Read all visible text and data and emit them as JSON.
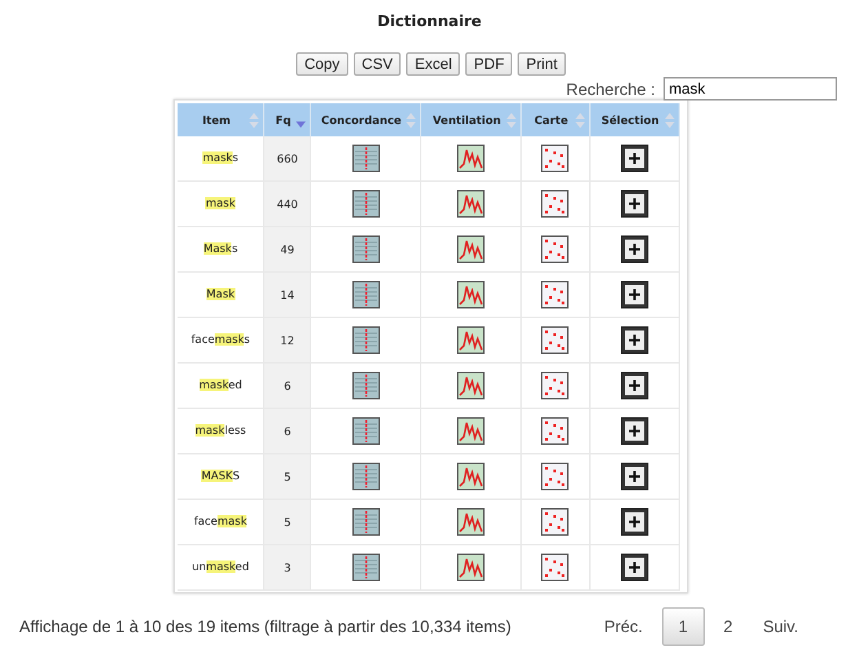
{
  "title": "Dictionnaire",
  "export_buttons": [
    "Copy",
    "CSV",
    "Excel",
    "PDF",
    "Print"
  ],
  "search": {
    "label": "Recherche :",
    "value": "mask"
  },
  "table": {
    "columns": [
      {
        "label": "Item",
        "sorted": false
      },
      {
        "label": "Fq",
        "sorted": true
      },
      {
        "label": "Concordance",
        "sorted": false
      },
      {
        "label": "Ventilation",
        "sorted": false
      },
      {
        "label": "Carte",
        "sorted": false
      },
      {
        "label": "Sélection",
        "sorted": false
      }
    ],
    "rows": [
      {
        "item": {
          "hit": "mask",
          "post": "s"
        },
        "fq": "660"
      },
      {
        "item": {
          "hit": "mask"
        },
        "fq": "440"
      },
      {
        "item": {
          "hit": "Mask",
          "post": "s"
        },
        "fq": "49"
      },
      {
        "item": {
          "hit": "Mask"
        },
        "fq": "14"
      },
      {
        "item": {
          "pre": "face",
          "hit": "mask",
          "post": "s"
        },
        "fq": "12"
      },
      {
        "item": {
          "hit": "mask",
          "post": "ed"
        },
        "fq": "6"
      },
      {
        "item": {
          "hit": "mask",
          "post": "less"
        },
        "fq": "6"
      },
      {
        "item": {
          "hit": "MASK",
          "post": "S"
        },
        "fq": "5"
      },
      {
        "item": {
          "pre": "face",
          "hit": "mask"
        },
        "fq": "5"
      },
      {
        "item": {
          "pre": "un",
          "hit": "mask",
          "post": "ed"
        },
        "fq": "3"
      }
    ]
  },
  "info": "Affichage de 1 à 10 des 19 items (filtrage à partir des 10,334 items)",
  "pagination": {
    "previous": "Préc.",
    "pages": [
      {
        "label": "1",
        "selected": true
      },
      {
        "label": "2",
        "selected": false
      }
    ],
    "next": "Suiv."
  }
}
